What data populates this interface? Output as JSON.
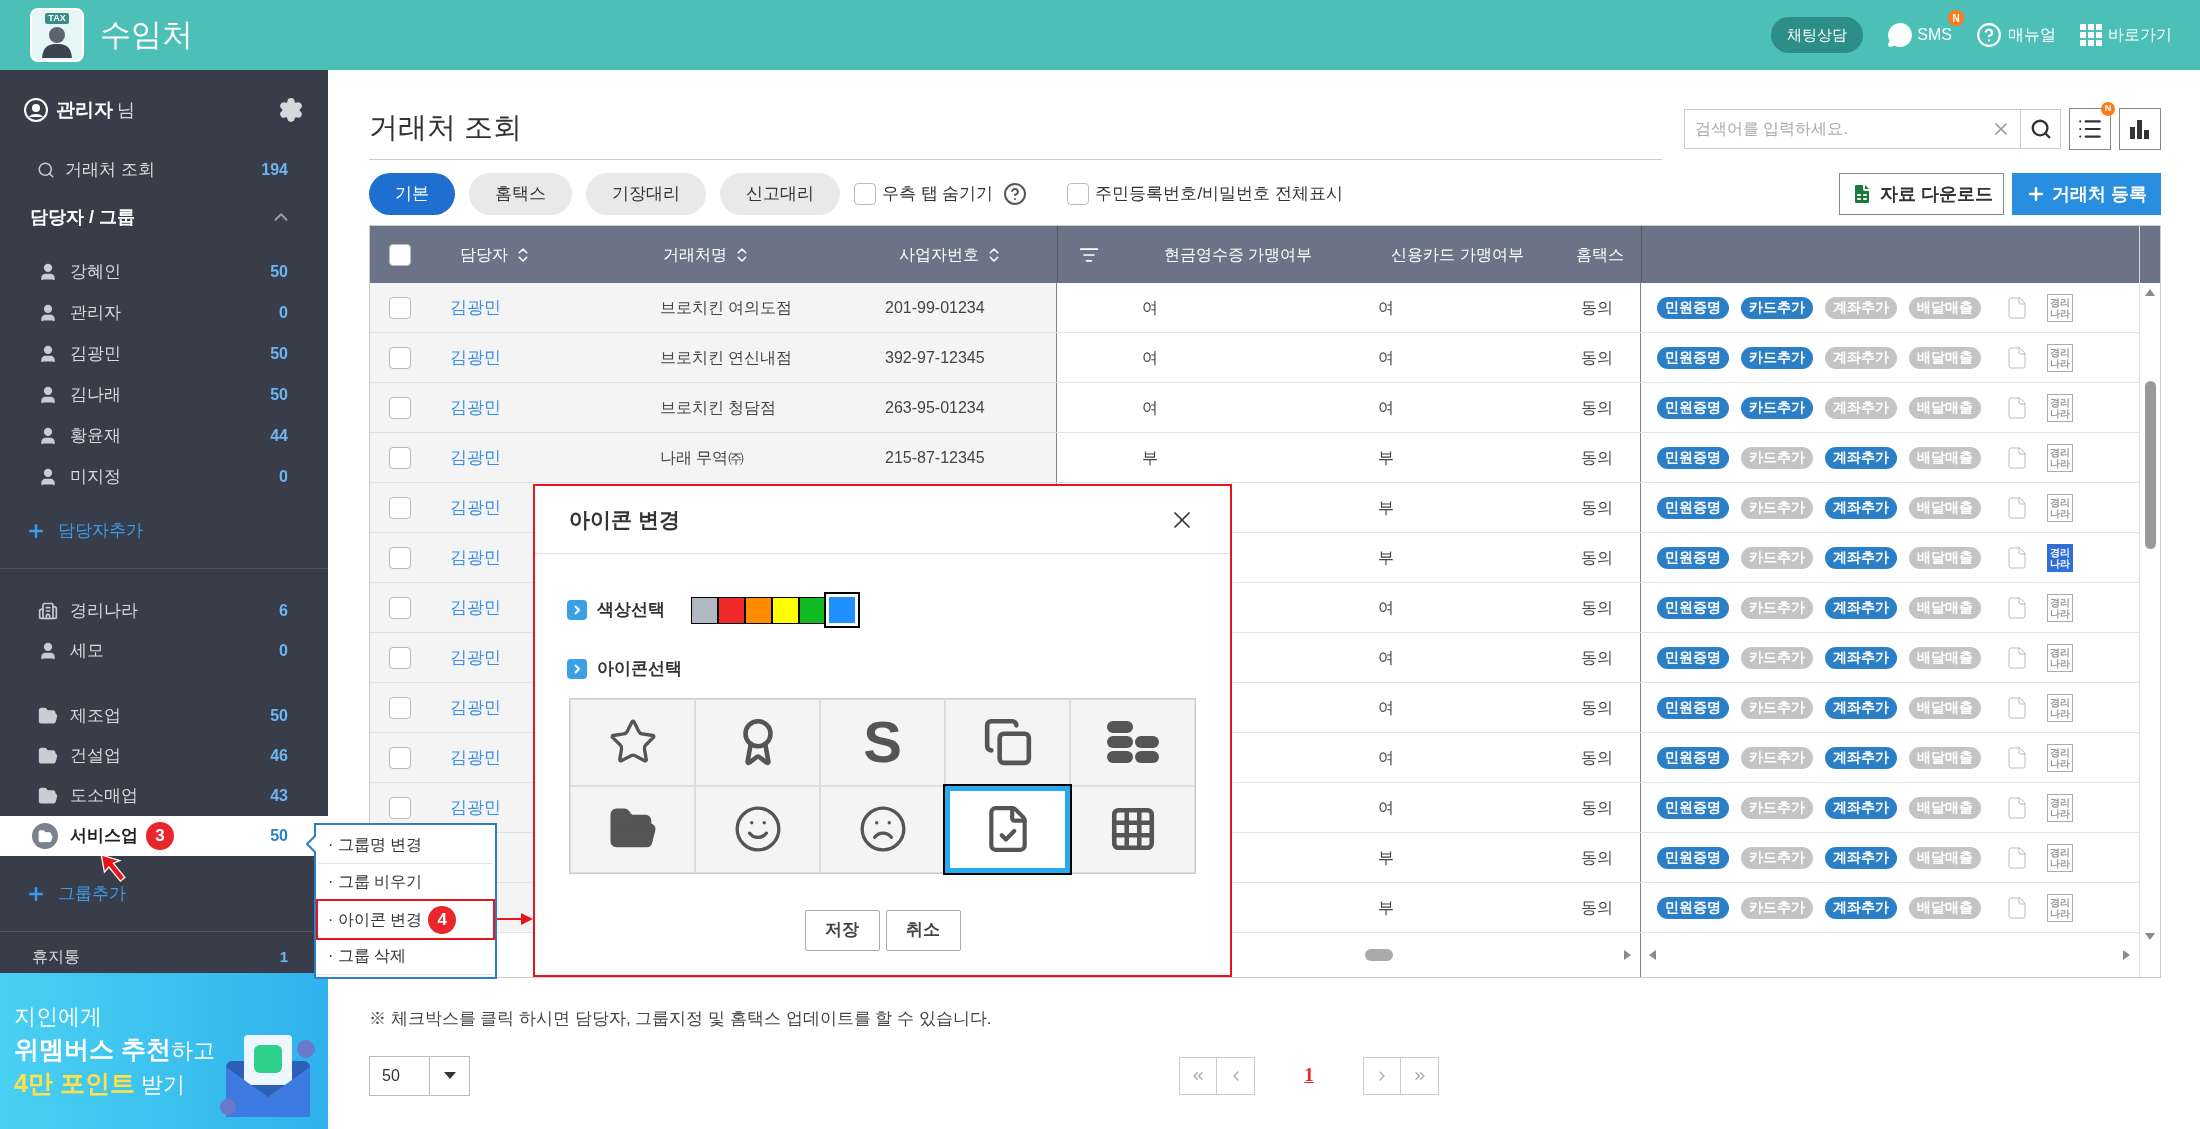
{
  "header": {
    "logo_badge": "TAX",
    "title": "수임처",
    "chat_button": "채팅상담",
    "sms": {
      "label": "SMS",
      "badge": "N"
    },
    "manual": "매뉴얼",
    "shortcuts": "바로가기"
  },
  "sidebar": {
    "user": {
      "name": "관리자",
      "suffix": "님"
    },
    "search_item": {
      "label": "거래처 조회",
      "count": "194"
    },
    "section": {
      "title": "담당자 / 그룹",
      "expanded": true
    },
    "managers": [
      {
        "name": "강혜인",
        "count": "50"
      },
      {
        "name": "관리자",
        "count": "0"
      },
      {
        "name": "김광민",
        "count": "50"
      },
      {
        "name": "김나래",
        "count": "50"
      },
      {
        "name": "황윤재",
        "count": "44"
      },
      {
        "name": "미지정",
        "count": "0"
      }
    ],
    "add_manager": "담당자추가",
    "groups": [
      {
        "kind": "building",
        "label": "경리나라",
        "count": "6",
        "selected": false
      },
      {
        "kind": "person",
        "label": "세모",
        "count": "0",
        "selected": false
      },
      {
        "kind": "folder",
        "label": "제조업",
        "count": "50",
        "selected": false
      },
      {
        "kind": "folder",
        "label": "건설업",
        "count": "46",
        "selected": false
      },
      {
        "kind": "folder",
        "label": "도소매업",
        "count": "43",
        "selected": false
      },
      {
        "kind": "folder",
        "label": "서비스업",
        "count": "50",
        "selected": true,
        "step": "3"
      }
    ],
    "add_group": "그룹추가",
    "trash": {
      "label": "휴지통",
      "count": "1"
    },
    "banner": [
      {
        "text": "지인에게"
      },
      {
        "text": "**위멤버스 추천**하고"
      },
      {
        "text": "**4만 포인트** 받기",
        "accent": true
      }
    ]
  },
  "page": {
    "title": "거래처 조회",
    "search": {
      "placeholder": "검색어를 입력하세요."
    },
    "list_badge": "N"
  },
  "tabs": [
    {
      "label": "기본",
      "selected": true
    },
    {
      "label": "홈택스",
      "selected": false
    },
    {
      "label": "기장대리",
      "selected": false
    },
    {
      "label": "신고대리",
      "selected": false
    }
  ],
  "options": [
    {
      "label": "우측 탭 숨기기",
      "checked": false,
      "help": true
    },
    {
      "label": "주민등록번호/비밀번호 전체표시",
      "checked": false,
      "help": false
    }
  ],
  "actions": [
    {
      "kind": "excel",
      "label": "자료 다운로드"
    },
    {
      "kind": "add",
      "label": "거래처 등록"
    }
  ],
  "table": {
    "select_all": false,
    "columns": [
      {
        "kind": "check"
      },
      {
        "kind": "sort",
        "label": "담당자"
      },
      {
        "kind": "sort",
        "label": "거래처명"
      },
      {
        "kind": "sort",
        "label": "사업자번호"
      },
      {
        "kind": "filter"
      },
      {
        "kind": "text",
        "label": "현금영수증 가맹여부"
      },
      {
        "kind": "text",
        "label": "신용카드 가맹여부"
      },
      {
        "kind": "text",
        "label": "홈택스"
      },
      {
        "kind": "blank"
      }
    ],
    "rows": [
      {
        "checked": false,
        "manager": "김광민",
        "name": "브로치킨 여의도점",
        "biz_no": "201-99-01234",
        "cash": "여",
        "card": "여",
        "hometax": "동의",
        "tags": [
          {
            "label": "민원증명",
            "on": true
          },
          {
            "label": "카드추가",
            "on": true
          },
          {
            "label": "계좌추가",
            "on": false
          },
          {
            "label": "배달매출",
            "on": false
          }
        ],
        "stamp": {
          "text": "경리나라",
          "on": false
        }
      },
      {
        "checked": false,
        "manager": "김광민",
        "name": "브로치킨 연신내점",
        "biz_no": "392-97-12345",
        "cash": "여",
        "card": "여",
        "hometax": "동의",
        "tags": [
          {
            "label": "민원증명",
            "on": true
          },
          {
            "label": "카드추가",
            "on": true
          },
          {
            "label": "계좌추가",
            "on": false
          },
          {
            "label": "배달매출",
            "on": false
          }
        ],
        "stamp": {
          "text": "경리나라",
          "on": false
        }
      },
      {
        "checked": false,
        "manager": "김광민",
        "name": "브로치킨 청담점",
        "biz_no": "263-95-01234",
        "cash": "여",
        "card": "여",
        "hometax": "동의",
        "tags": [
          {
            "label": "민원증명",
            "on": true
          },
          {
            "label": "카드추가",
            "on": true
          },
          {
            "label": "계좌추가",
            "on": false
          },
          {
            "label": "배달매출",
            "on": false
          }
        ],
        "stamp": {
          "text": "경리나라",
          "on": false
        }
      },
      {
        "checked": false,
        "manager": "김광민",
        "name": "나래 무역㈜",
        "biz_no": "215-87-12345",
        "cash": "부",
        "card": "부",
        "hometax": "동의",
        "tags": [
          {
            "label": "민원증명",
            "on": true
          },
          {
            "label": "카드추가",
            "on": false
          },
          {
            "label": "계좌추가",
            "on": true
          },
          {
            "label": "배달매출",
            "on": false
          }
        ],
        "stamp": {
          "text": "경리나라",
          "on": false
        }
      },
      {
        "checked": false,
        "manager": "김광민",
        "card": "부",
        "hometax": "동의",
        "tags": [
          {
            "label": "민원증명",
            "on": true
          },
          {
            "label": "카드추가",
            "on": false
          },
          {
            "label": "계좌추가",
            "on": true
          },
          {
            "label": "배달매출",
            "on": false
          }
        ],
        "stamp": {
          "text": "경리나라",
          "on": false
        }
      },
      {
        "checked": false,
        "manager": "김광민",
        "card": "부",
        "hometax": "동의",
        "tags": [
          {
            "label": "민원증명",
            "on": true
          },
          {
            "label": "카드추가",
            "on": false
          },
          {
            "label": "계좌추가",
            "on": true
          },
          {
            "label": "배달매출",
            "on": false
          }
        ],
        "stamp": {
          "text": "경리나라",
          "on": true
        }
      },
      {
        "checked": false,
        "manager": "김광민",
        "card": "여",
        "hometax": "동의",
        "tags": [
          {
            "label": "민원증명",
            "on": true
          },
          {
            "label": "카드추가",
            "on": false
          },
          {
            "label": "계좌추가",
            "on": true
          },
          {
            "label": "배달매출",
            "on": false
          }
        ],
        "stamp": {
          "text": "경리나라",
          "on": false
        }
      },
      {
        "checked": false,
        "manager": "김광민",
        "card": "여",
        "hometax": "동의",
        "tags": [
          {
            "label": "민원증명",
            "on": true
          },
          {
            "label": "카드추가",
            "on": false
          },
          {
            "label": "계좌추가",
            "on": true
          },
          {
            "label": "배달매출",
            "on": false
          }
        ],
        "stamp": {
          "text": "경리나라",
          "on": false
        }
      },
      {
        "checked": false,
        "manager": "김광민",
        "card": "여",
        "hometax": "동의",
        "tags": [
          {
            "label": "민원증명",
            "on": true
          },
          {
            "label": "카드추가",
            "on": false
          },
          {
            "label": "계좌추가",
            "on": true
          },
          {
            "label": "배달매출",
            "on": false
          }
        ],
        "stamp": {
          "text": "경리나라",
          "on": false
        }
      },
      {
        "checked": false,
        "manager": "김광민",
        "card": "여",
        "hometax": "동의",
        "tags": [
          {
            "label": "민원증명",
            "on": true
          },
          {
            "label": "카드추가",
            "on": false
          },
          {
            "label": "계좌추가",
            "on": true
          },
          {
            "label": "배달매출",
            "on": false
          }
        ],
        "stamp": {
          "text": "경리나라",
          "on": false
        }
      },
      {
        "checked": false,
        "manager": "김광민",
        "card": "여",
        "hometax": "동의",
        "tags": [
          {
            "label": "민원증명",
            "on": true
          },
          {
            "label": "카드추가",
            "on": false
          },
          {
            "label": "계좌추가",
            "on": true
          },
          {
            "label": "배달매출",
            "on": false
          }
        ],
        "stamp": {
          "text": "경리나라",
          "on": false
        }
      },
      {
        "card": "부",
        "hometax": "동의",
        "tags": [
          {
            "label": "민원증명",
            "on": true
          },
          {
            "label": "카드추가",
            "on": false
          },
          {
            "label": "계좌추가",
            "on": true
          },
          {
            "label": "배달매출",
            "on": false
          }
        ],
        "stamp": {
          "text": "경리나라",
          "on": false
        }
      },
      {
        "card": "부",
        "hometax": "동의",
        "tags": [
          {
            "label": "민원증명",
            "on": true
          },
          {
            "label": "카드추가",
            "on": false
          },
          {
            "label": "계좌추가",
            "on": true
          },
          {
            "label": "배달매출",
            "on": false
          }
        ],
        "stamp": {
          "text": "경리나라",
          "on": false
        }
      }
    ]
  },
  "note": "※ 체크박스를 클릭 하시면 담당자, 그룹지정 및 홈택스 업데이트를 할 수 있습니다.",
  "page_size": "50",
  "pagination": {
    "pages": [
      {
        "label": "1",
        "selected": true
      }
    ]
  },
  "context_menu": {
    "items": [
      {
        "label": "· 그룹명 변경",
        "marked": false
      },
      {
        "label": "· 그룹 비우기",
        "marked": false
      },
      {
        "label": "· 아이콘 변경",
        "marked": true,
        "step": "4"
      },
      {
        "label": "· 그룹 삭제",
        "marked": false
      }
    ]
  },
  "dialog": {
    "title": "아이콘 변경",
    "color_label": "색상선택",
    "icon_label": "아이콘선택",
    "colors": [
      {
        "color": "#b0b8c1",
        "selected": false
      },
      {
        "color": "#f02a2a",
        "selected": false
      },
      {
        "color": "#ff8c00",
        "selected": false
      },
      {
        "color": "#ffff00",
        "selected": false
      },
      {
        "color": "#11bb22",
        "selected": false
      },
      {
        "color": "#1e90ff",
        "selected": true
      }
    ],
    "icons": [
      {
        "kind": "star",
        "selected": false
      },
      {
        "kind": "award",
        "selected": false
      },
      {
        "kind": "letter",
        "text": "S",
        "selected": false
      },
      {
        "kind": "copy",
        "selected": false
      },
      {
        "kind": "stack",
        "selected": false
      },
      {
        "kind": "folder",
        "selected": false
      },
      {
        "kind": "smile",
        "selected": false
      },
      {
        "kind": "frown",
        "selected": false
      },
      {
        "kind": "checklist",
        "selected": true
      },
      {
        "kind": "grid-edit",
        "selected": false
      }
    ],
    "buttons": [
      "저장",
      "취소"
    ]
  }
}
